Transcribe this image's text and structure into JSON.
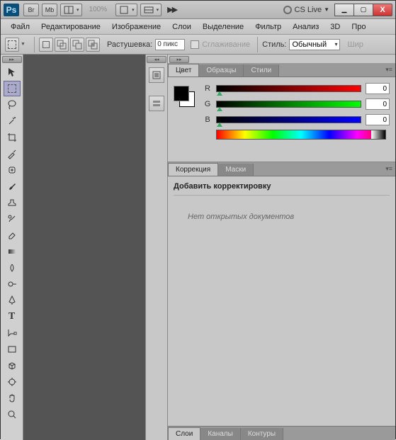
{
  "titlebar": {
    "logo": "Ps",
    "br": "Br",
    "mb": "Mb",
    "zoom": "100%",
    "cslive": "CS Live"
  },
  "win": {
    "min": "▁",
    "max": "▢",
    "close": "X"
  },
  "menu": [
    "Файл",
    "Редактирование",
    "Изображение",
    "Слои",
    "Выделение",
    "Фильтр",
    "Анализ",
    "3D",
    "Про"
  ],
  "options": {
    "feather_label": "Растушевка:",
    "feather_value": "0 пикс",
    "antialias": "Сглаживание",
    "style_label": "Стиль:",
    "style_value": "Обычный",
    "width_label": "Шир"
  },
  "color_panel": {
    "tabs": [
      "Цвет",
      "Образцы",
      "Стили"
    ],
    "r": "R",
    "g": "G",
    "b": "B",
    "rv": "0",
    "gv": "0",
    "bv": "0"
  },
  "corr_panel": {
    "tabs": [
      "Коррекция",
      "Маски"
    ],
    "heading": "Добавить корректировку",
    "msg": "Нет открытых документов"
  },
  "bottom_tabs": [
    "Слои",
    "Каналы",
    "Контуры"
  ]
}
